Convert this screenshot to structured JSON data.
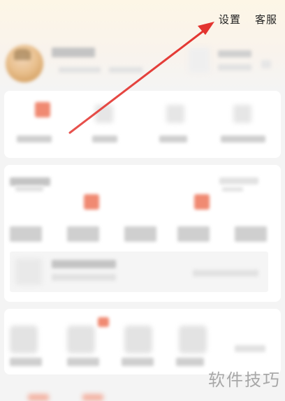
{
  "header": {
    "settings_label": "设置",
    "service_label": "客服"
  },
  "watermark": {
    "text": "软件技巧"
  },
  "colors": {
    "arrow": "#e3342f",
    "accent": "#f08a72",
    "header_gradient_top": "#fdf6e6"
  },
  "icons": {
    "arrow": "red-arrow-annotation"
  }
}
